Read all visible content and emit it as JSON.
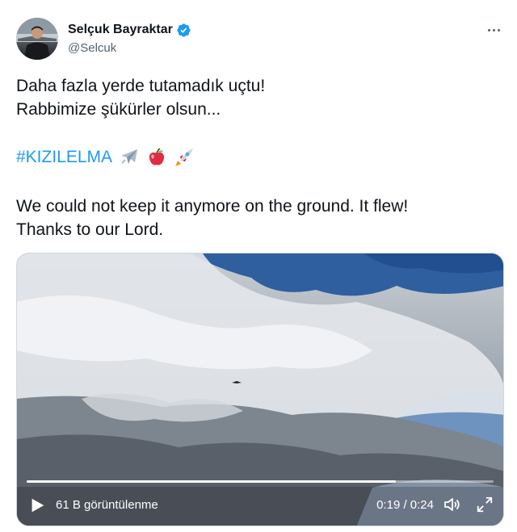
{
  "author": {
    "display_name": "Selçuk Bayraktar",
    "handle": "@Selcuk",
    "verified": true,
    "avatar_icon": "profile-photo"
  },
  "tweet": {
    "line1": "Daha fazla yerde tutamadık uçtu!",
    "line2": "Rabbimize şükürler olsun...",
    "hashtag": "#KIZILELMA",
    "emojis": [
      "airplane-emoji",
      "red-apple-emoji",
      "rocket-emoji"
    ],
    "en_line1": "We could not keep it anymore on the ground. It flew!",
    "en_line2": "Thanks to our Lord."
  },
  "video": {
    "views": "61 B görüntülenme",
    "time": "0:19 / 0:24",
    "progress_fraction": 0.79
  },
  "colors": {
    "link": "#1d9bf0",
    "text": "#0f1419",
    "secondary": "#536471"
  }
}
